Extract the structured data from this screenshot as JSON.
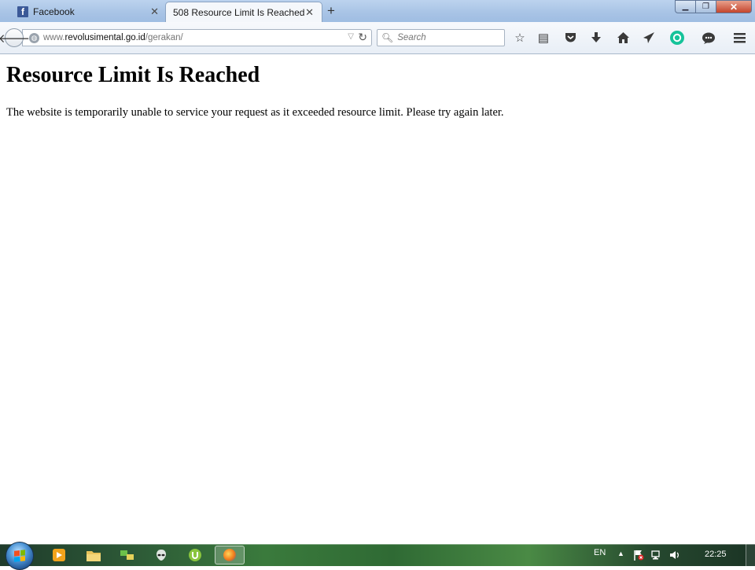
{
  "tabs": [
    {
      "title": "Facebook",
      "favicon": "facebook-icon",
      "active": false
    },
    {
      "title": "508 Resource Limit Is Reached",
      "favicon": "",
      "active": true
    }
  ],
  "new_tab_label": "+",
  "window_controls": {
    "minimize": "minimize-icon",
    "maximize": "restore-icon",
    "close": "close-icon"
  },
  "url": {
    "prefix": "www.",
    "domain": "revolusimental.go.id",
    "path": "/gerakan/"
  },
  "search": {
    "placeholder": "Search"
  },
  "toolbar_icons": [
    "bookmark-star-icon",
    "reading-list-icon",
    "pocket-icon",
    "download-icon",
    "home-icon",
    "send-icon",
    "grammarly-icon",
    "chat-icon",
    "menu-icon"
  ],
  "page": {
    "heading": "Resource Limit Is Reached",
    "message": "The website is temporarily unable to service your request as it exceeded resource limit. Please try again later."
  },
  "taskbar": {
    "pinned": [
      "media-player-icon",
      "file-explorer-icon",
      "network-app-icon",
      "alien-app-icon",
      "utorrent-icon",
      "firefox-icon"
    ],
    "language": "EN",
    "clock": "22:25"
  },
  "colors": {
    "accent_tab": "#f4f7fb",
    "titlebar": "#a9c4e6",
    "taskbar": "#2d5a37",
    "close_button": "#c4452c"
  }
}
